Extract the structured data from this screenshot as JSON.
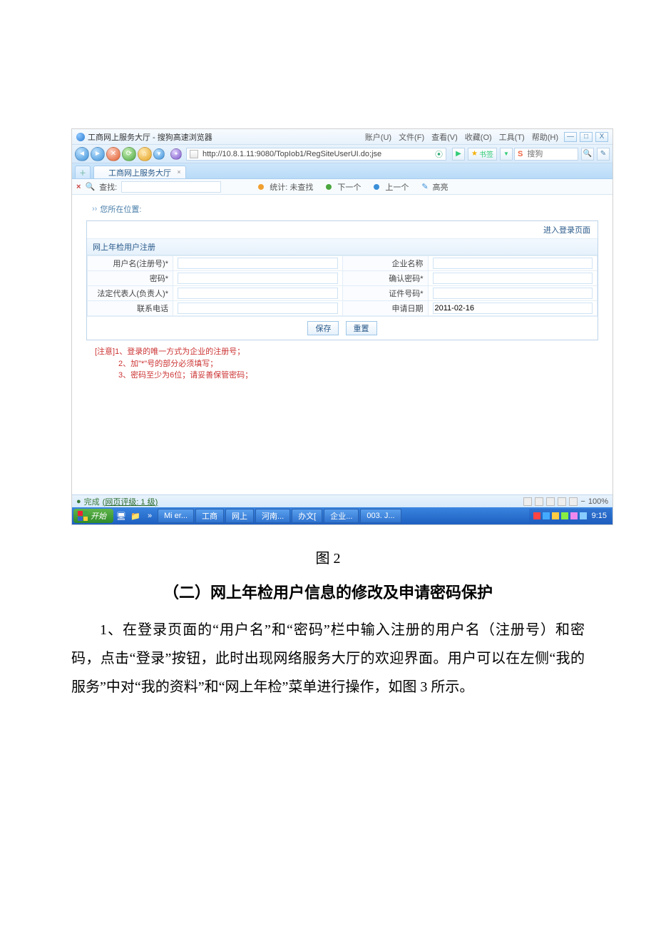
{
  "titlebar": {
    "title": "工商网上服务大厅 - 搜狗高速浏览器",
    "menus": {
      "account": "账户(U)",
      "file": "文件(F)",
      "view": "查看(V)",
      "favorites": "收藏(O)",
      "tools": "工具(T)",
      "help": "帮助(H)"
    },
    "winbtns": {
      "min": "—",
      "max": "□",
      "close": "X"
    }
  },
  "addressbar": {
    "url": "http://10.8.1.11:9080/TopIob1/RegSiteUserUI.do;jse",
    "go_label": "▶",
    "bookmark_label": "书签",
    "search_brand": "S",
    "search_placeholder": "搜狗"
  },
  "tabsrow": {
    "newtab_label": "＋",
    "tab_title": "工商网上服务大厅",
    "tab_close": "×"
  },
  "findbar": {
    "close": "×",
    "search_icon": "🔍",
    "search_label": "查找:",
    "stats": "统计: 未查找",
    "next": "下一个",
    "prev": "上一个",
    "highlight": "高亮"
  },
  "crumb": "您所在位置:",
  "panel": {
    "login_link": "进入登录页面",
    "header": "网上年检用户注册",
    "labels": {
      "username": "用户名(注册号)*",
      "company": "企业名称",
      "password": "密码*",
      "confirm": "确认密码*",
      "legal": "法定代表人(负责人)*",
      "idno": "证件号码*",
      "phone": "联系电话",
      "applydate": "申请日期"
    },
    "values": {
      "applydate": "2011-02-16"
    },
    "buttons": {
      "save": "保存",
      "reset": "重置"
    }
  },
  "notes": {
    "prefix": "[注意]",
    "l1": "1、登录的唯一方式为企业的注册号；",
    "l2": "2、加\"*\"号的部分必须填写；",
    "l3": "3、密码至少为6位；请妥善保管密码；"
  },
  "statusbar": {
    "done": "完成",
    "rating": "(网页评级: 1 级)",
    "zoom": "100%"
  },
  "taskbar": {
    "start": "开始",
    "items": {
      "a": "Mi er...",
      "b": "工商",
      "c": "网上",
      "d": "河南...",
      "e": "办文[",
      "f": "企业...",
      "g": "003. J..."
    },
    "clock": "9:15"
  },
  "doc": {
    "figcap": "图 2",
    "section_heading": "（二）网上年检用户信息的修改及申请密码保护",
    "para1": "1、在登录页面的“用户名”和“密码”栏中输入注册的用户名（注册号）和密码，点击“登录”按钮，此时出现网络服务大厅的欢迎界面。用户可以在左侧“我的服务”中对“我的资料”和“网上年检”菜单进行操作，如图 3 所示。"
  }
}
